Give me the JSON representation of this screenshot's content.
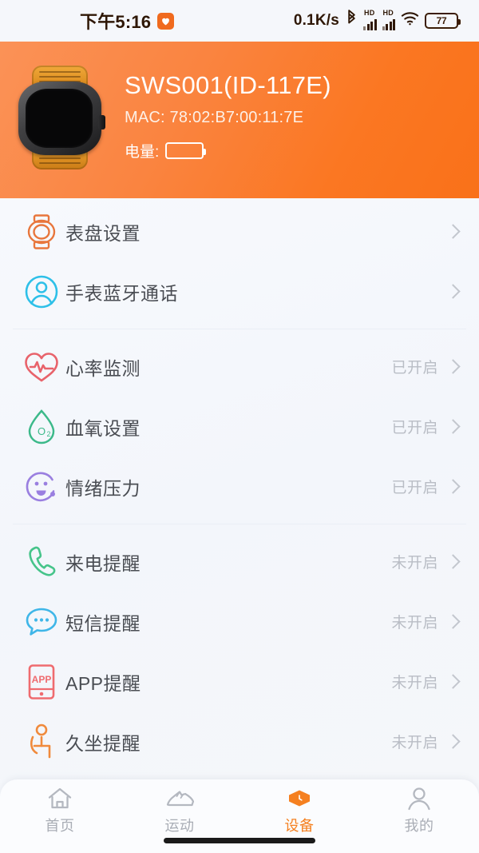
{
  "statusbar": {
    "time": "下午5:16",
    "heart_icon": "heart-icon",
    "netspeed": "0.1K/s",
    "bluetooth_icon": "bluetooth-icon",
    "hd_label_1": "HD",
    "hd_label_2": "HD",
    "wifi_icon": "wifi-icon",
    "battery_percent": "77"
  },
  "header": {
    "device_name": "SWS001(ID-117E)",
    "mac": "MAC: 78:02:B7:00:11:7E",
    "battery_label": "电量:",
    "device_icon": "smartwatch-image",
    "gradient_from": "#fb9257",
    "gradient_to": "#f97119"
  },
  "groups": [
    {
      "rows": [
        {
          "icon": "watch-face-icon",
          "icon_color": "#e8763c",
          "label": "表盘设置",
          "state": ""
        },
        {
          "icon": "bluetooth-call-person-icon",
          "icon_color": "#2ec0e8",
          "label": "手表蓝牙通话",
          "state": ""
        }
      ]
    },
    {
      "rows": [
        {
          "icon": "heart-rate-icon",
          "icon_color": "#e8636b",
          "label": "心率监测",
          "state": "已开启"
        },
        {
          "icon": "blood-oxygen-droplet-icon",
          "icon_color": "#3cb98a",
          "label": "血氧设置",
          "state": "已开启"
        },
        {
          "icon": "mood-stress-face-icon",
          "icon_color": "#9a7fe0",
          "label": "情绪压力",
          "state": "已开启"
        }
      ]
    },
    {
      "rows": [
        {
          "icon": "incoming-call-icon",
          "icon_color": "#46c48a",
          "label": "来电提醒",
          "state": "未开启"
        },
        {
          "icon": "sms-bubble-icon",
          "icon_color": "#3fb6e8",
          "label": "短信提醒",
          "state": "未开启"
        },
        {
          "icon": "app-notification-icon",
          "icon_color": "#ef6b6f",
          "label": "APP提醒",
          "state": "未开启"
        },
        {
          "icon": "sedentary-person-icon",
          "icon_color": "#f08a3c",
          "label": "久坐提醒",
          "state": "未开启"
        }
      ]
    }
  ],
  "tabbar": {
    "active_color": "#f58020",
    "inactive_color": "#a9adb5",
    "tabs": [
      {
        "icon": "home-icon",
        "label": "首页",
        "active": false
      },
      {
        "icon": "running-shoe-icon",
        "label": "运动",
        "active": false
      },
      {
        "icon": "watch-device-icon",
        "label": "设备",
        "active": true
      },
      {
        "icon": "profile-person-icon",
        "label": "我的",
        "active": false
      }
    ]
  }
}
